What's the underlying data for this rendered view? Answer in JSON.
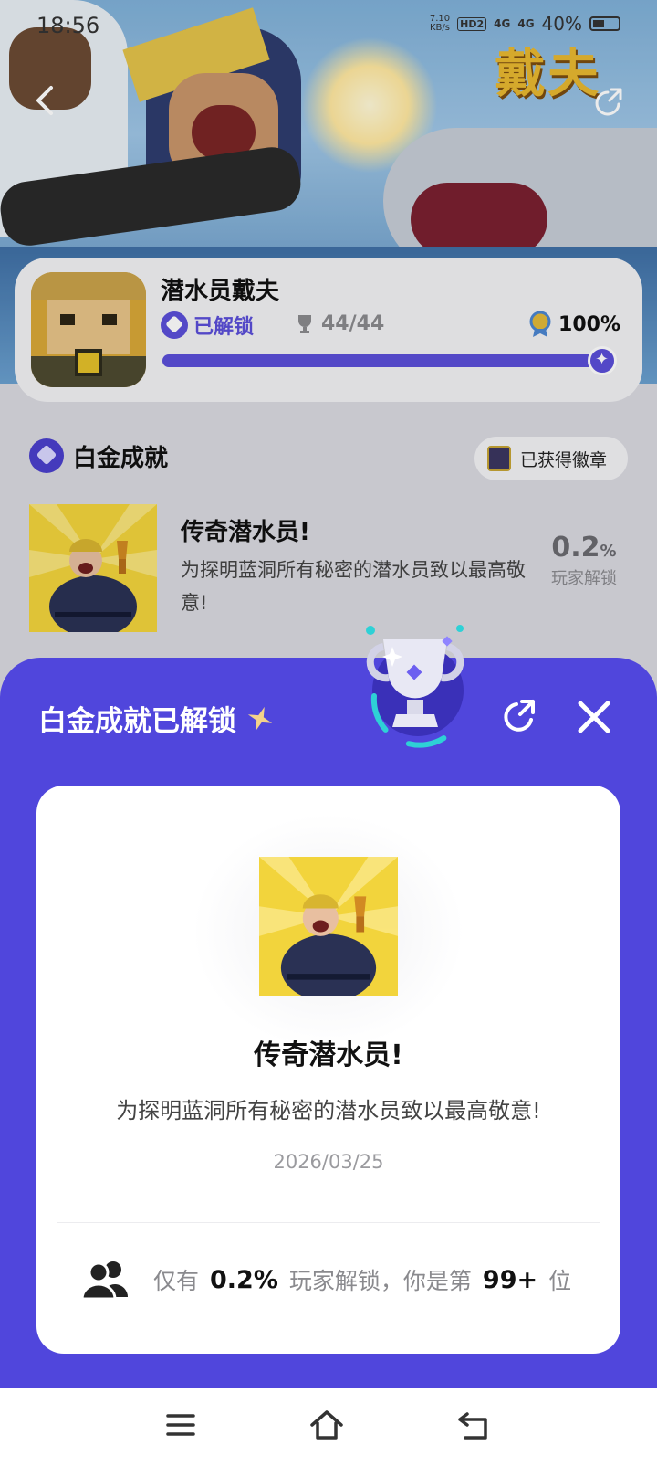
{
  "status_bar": {
    "time": "18:56",
    "net_speed": "7.10",
    "net_unit": "KB/s",
    "hd": "HD2",
    "signal_1": "4G",
    "signal_2": "4G",
    "battery": "40%"
  },
  "hero": {
    "logo_text": "戴夫"
  },
  "game": {
    "title": "潜水员戴夫",
    "unlocked_label": "已解锁",
    "trophy_count": "44/44",
    "completion": "100%",
    "progress": 1.0
  },
  "platinum": {
    "section_title": "白金成就",
    "badge_button": "已获得徽章",
    "achievement": {
      "title": "传奇潜水员!",
      "description": "为探明蓝洞所有秘密的潜水员致以最高敬意!",
      "rate": "0.2",
      "rate_unit": "%",
      "rate_label": "玩家解锁"
    }
  },
  "sheet": {
    "title": "白金成就已解锁",
    "card": {
      "title": "传奇潜水员!",
      "description": "为探明蓝洞所有秘密的潜水员致以最高敬意!",
      "date": "2026/03/25",
      "stat_prefix": "仅有",
      "stat_rate": "0.2%",
      "stat_mid": "玩家解锁，你是第",
      "stat_rank": "99+",
      "stat_suffix": "位"
    }
  },
  "icons": {
    "back": "chevron-left-icon",
    "share": "share-icon",
    "close": "close-icon",
    "trophy": "trophy-icon",
    "people": "people-icon",
    "menu": "menu-icon",
    "home": "home-icon",
    "back_nav": "back-icon"
  },
  "colors": {
    "accent": "#5046dc",
    "progress": "#5b4fd8"
  }
}
